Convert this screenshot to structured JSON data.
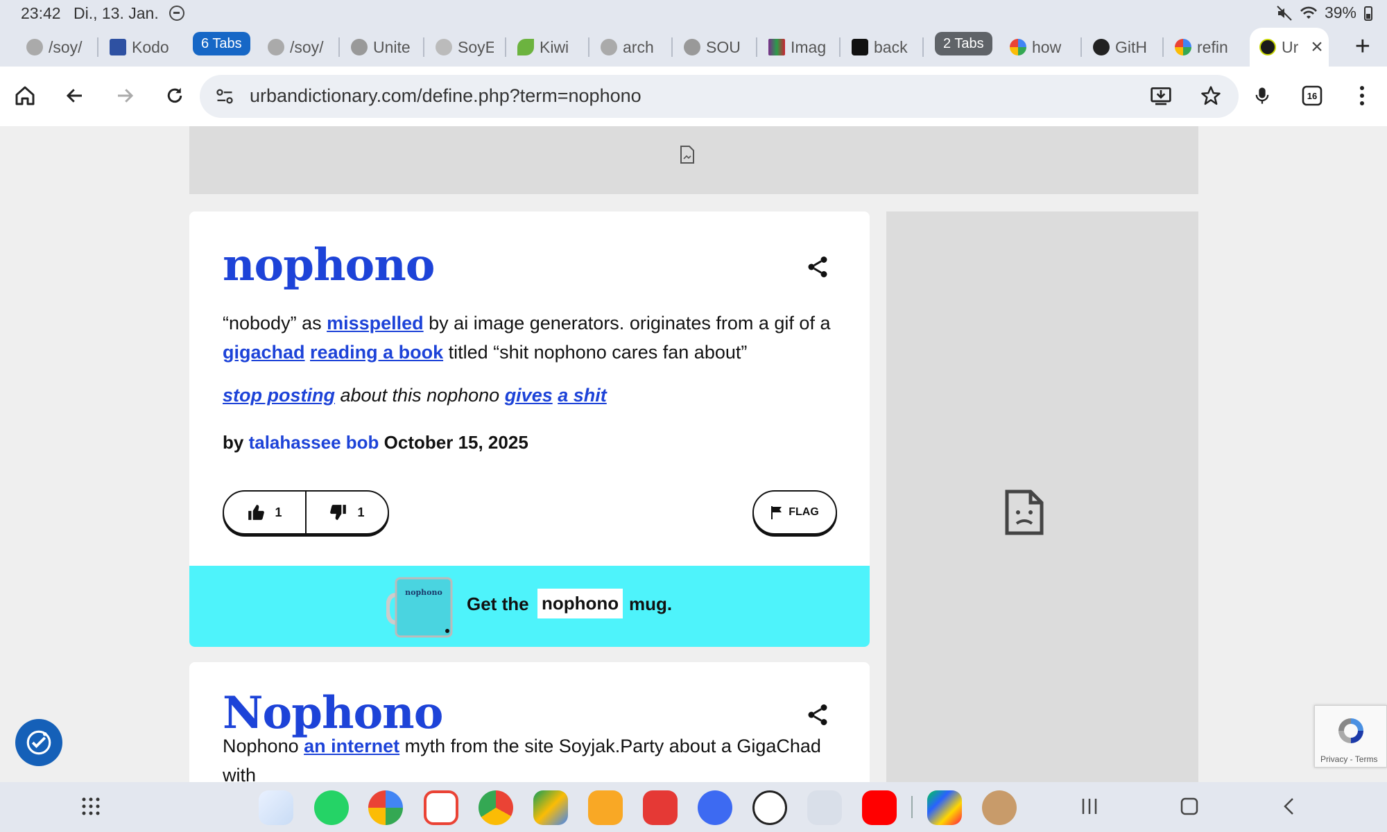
{
  "status_bar": {
    "time": "23:42",
    "date": "Di., 13. Jan.",
    "battery": "39%"
  },
  "tabs": [
    {
      "label": "/soy/",
      "color": "#888888"
    },
    {
      "label": "Kodo",
      "color": "#2e51a2"
    },
    {
      "label": "/soy/",
      "color": "#888888"
    },
    {
      "label": "Unite",
      "color": "#666666"
    },
    {
      "label": "SoyE",
      "color": "#777777"
    },
    {
      "label": "Kiwi",
      "color": "#6cb33f"
    },
    {
      "label": "arch",
      "color": "#888888"
    },
    {
      "label": "SOU",
      "color": "#777777"
    },
    {
      "label": "Imag",
      "color": "#7a2d8c"
    },
    {
      "label": "back",
      "color": "#111111"
    },
    {
      "label": "how",
      "color": "#4285f4"
    },
    {
      "label": "GitH",
      "color": "#222222"
    },
    {
      "label": "refin",
      "color": "#4285f4"
    },
    {
      "label": "Ur",
      "color": "#1b1b1b"
    }
  ],
  "tab_groups": {
    "group1_label": "6 Tabs",
    "group2_label": "2 Tabs"
  },
  "toolbar": {
    "url": "urbandictionary.com/define.php?term=nophono",
    "tab_count": "16"
  },
  "entry1": {
    "word": "nophono",
    "meaning_part1": "“nobody” as ",
    "link_misspelled": "misspelled",
    "meaning_part2": " by ai image generators. originates from a gif of a ",
    "link_gigachad": "gigachad",
    "link_reading": "reading a book",
    "meaning_part3": " titled “shit nophono cares fan about”",
    "example_link1": "stop posting",
    "example_mid": " about this nophono ",
    "example_link2": "gives",
    "example_link3": "a shit",
    "by_prefix": "by ",
    "author": "talahassee bob",
    "date": " October 15, 2025",
    "upvotes": "1",
    "downvotes": "1",
    "flag_label": "FLAG"
  },
  "mug": {
    "prefix": "Get the",
    "word": "nophono",
    "suffix": "mug.",
    "mug_text": "nophono"
  },
  "entry2": {
    "word": "Nophono",
    "meaning_part1": "Nophono ",
    "link_internet": "an internet",
    "meaning_part2": " myth from the site Soyjak.Party about a GigaChad with"
  },
  "recaptcha": {
    "links": "Privacy - Terms"
  },
  "colors": {
    "link_blue": "#1d43d8",
    "mug_bar": "#4ef3fb",
    "tab_group": "#1667c6"
  }
}
